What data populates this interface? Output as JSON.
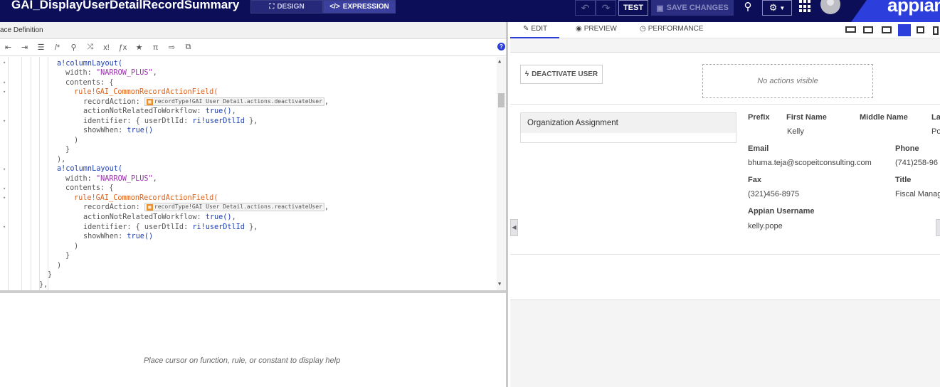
{
  "topbar": {
    "title": "GAI_DisplayUserDetailRecordSummary",
    "design_label": "DESIGN",
    "expression_label": "EXPRESSION",
    "test_label": "TEST",
    "save_label": "SAVE CHANGES",
    "brand": "appian",
    "colors": {
      "bar": "#0c0e58",
      "brand": "#2c3edb"
    }
  },
  "editor": {
    "header": "ace Definition",
    "help_text": "Place cursor on function, rule, or constant to display help",
    "code": {
      "l1_fn": "a!columnLayout(",
      "l2_key": "width: ",
      "l2_val": "\"NARROW_PLUS\"",
      "l2_end": ",",
      "l3": "contents: {",
      "l4_rule": "rule!GAI_CommonRecordActionField(",
      "l5_key": "recordAction: ",
      "l5_token": "recordType!GAI User Detail.actions.deactivateUser",
      "l5_end": ",",
      "l6_key": "actionNotRelatedToWorkflow: ",
      "l6_val": "true()",
      "l6_end": ",",
      "l7_key": "identifier: { userDtlId: ",
      "l7_val": "ri!userDtlId",
      "l7_end": " },",
      "l8_key": "showWhen: ",
      "l8_val": "true()",
      "l9": ")",
      "l10": "}",
      "l11": "),",
      "l12_fn": "a!columnLayout(",
      "l13_key": "width: ",
      "l13_val": "\"NARROW_PLUS\"",
      "l13_end": ",",
      "l14": "contents: {",
      "l15_rule": "rule!GAI_CommonRecordActionField(",
      "l16_key": "recordAction: ",
      "l16_token": "recordType!GAI User Detail.actions.reactivateUser",
      "l16_end": ",",
      "l17_key": "actionNotRelatedToWorkflow: ",
      "l17_val": "true()",
      "l17_end": ",",
      "l18_key": "identifier: { userDtlId: ",
      "l18_val": "ri!userDtlId",
      "l18_end": " },",
      "l19_key": "showWhen: ",
      "l19_val": "true()",
      "l20": ")",
      "l21": "}",
      "l22": ")",
      "l23": "}",
      "l24": "},"
    }
  },
  "preview": {
    "tabs": {
      "edit": "EDIT",
      "preview": "PREVIEW",
      "performance": "PERFORMANCE"
    },
    "deactivate_label": "DEACTIVATE USER",
    "no_actions": "No actions visible",
    "org_title": "Organization Assignment",
    "fields": {
      "prefix_label": "Prefix",
      "first_name_label": "First Name",
      "first_name": "Kelly",
      "middle_name_label": "Middle Name",
      "last_name_label": "La",
      "last_name": "Po",
      "email_label": "Email",
      "email": "bhuma.teja@scopeitconsulting.com",
      "phone_label": "Phone",
      "phone": "(741)258-96",
      "fax_label": "Fax",
      "fax": "(321)456-8975",
      "title_label": "Title",
      "title": "Fiscal Manag",
      "username_label": "Appian Username",
      "username": "kelly.pope"
    }
  }
}
